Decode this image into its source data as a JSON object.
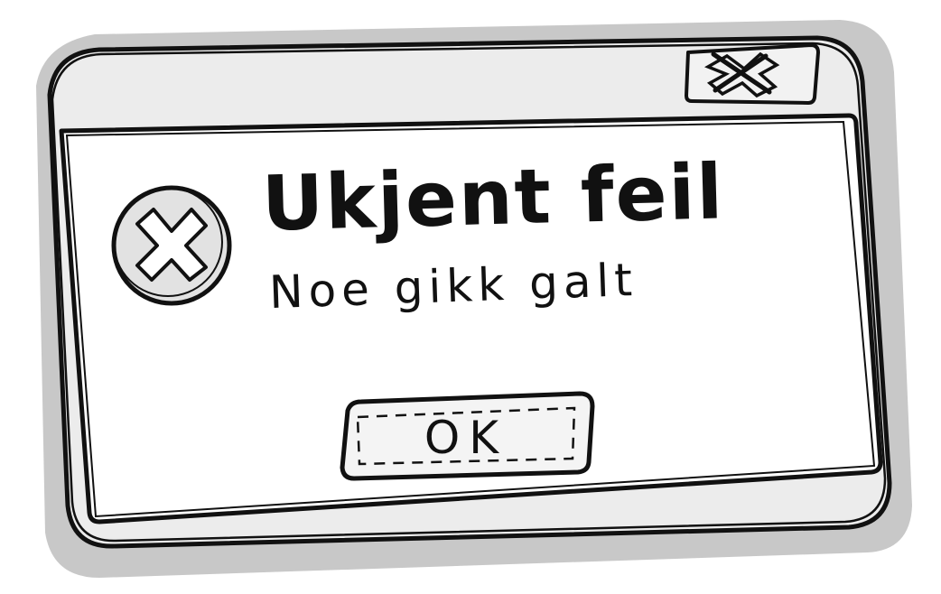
{
  "dialog": {
    "title": "Ukjent feil",
    "message": "Noe gikk galt",
    "ok_label": "OK",
    "close_icon": "close-icon",
    "error_icon": "error-x-icon"
  },
  "colors": {
    "stroke": "#111111",
    "shadow": "#c8c8c8",
    "titlebar": "#ececec",
    "body": "#ffffff"
  }
}
